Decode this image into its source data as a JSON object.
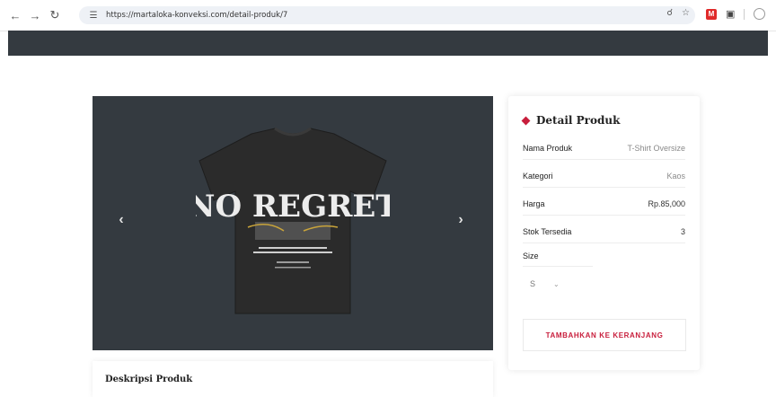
{
  "browser": {
    "url": "https://martaloka-konveksi.com/detail-produk/7",
    "back_icon": "arrow-left-icon",
    "forward_icon": "arrow-right-icon",
    "reload_icon": "reload-icon"
  },
  "gallery": {
    "prev_label": "‹",
    "next_label": "›",
    "shirt_text": "NO REGRET"
  },
  "description": {
    "title": "Deskripsi Produk"
  },
  "detail": {
    "title": "Detail Produk",
    "rows": [
      {
        "label": "Nama Produk",
        "value": "T-Shirt Oversize"
      },
      {
        "label": "Kategori",
        "value": "Kaos"
      },
      {
        "label": "Harga",
        "value": "Rp.85,000"
      },
      {
        "label": "Stok Tersedia",
        "value": "3"
      }
    ],
    "size_label": "Size",
    "size_selected": "S",
    "add_to_cart": "TAMBAHKAN KE KERANJANG"
  },
  "colors": {
    "accent": "#c81e3c",
    "dark_bar": "#343a40"
  }
}
